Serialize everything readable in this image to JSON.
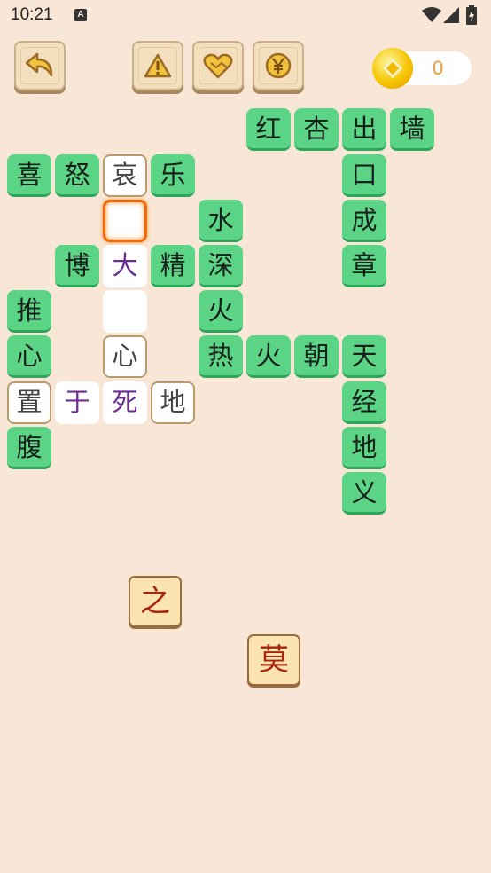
{
  "status_bar": {
    "time": "10:21",
    "notification": "A"
  },
  "toolbar": {
    "back_icon": "undo-arrow-icon",
    "warning_icon": "warning-icon",
    "heart_icon": "heart-icon",
    "yen_icon": "yen-coin-icon"
  },
  "coins": {
    "count": "0",
    "icon": "gold-coin-icon"
  },
  "board": {
    "r0": [
      "红",
      "杏",
      "出",
      "墙"
    ],
    "r1": [
      "喜",
      "怒",
      "哀",
      "乐",
      "口"
    ],
    "r2": [
      "水",
      "成"
    ],
    "r3": [
      "博",
      "大",
      "精",
      "深",
      "章"
    ],
    "r4": [
      "推",
      "火"
    ],
    "r5": [
      "心",
      "心",
      "热",
      "火",
      "朝",
      "天"
    ],
    "r6": [
      "置",
      "于",
      "死",
      "地",
      "经"
    ],
    "r7": [
      "腹",
      "地"
    ],
    "r8": [
      "义"
    ]
  },
  "choices": [
    "之",
    "莫"
  ],
  "colors": {
    "background": "#f8e6d6",
    "tile_green": "#5bd486",
    "selected_border": "#f06a10",
    "filled_text": "#6a2d92",
    "choice_text": "#a8250c"
  }
}
